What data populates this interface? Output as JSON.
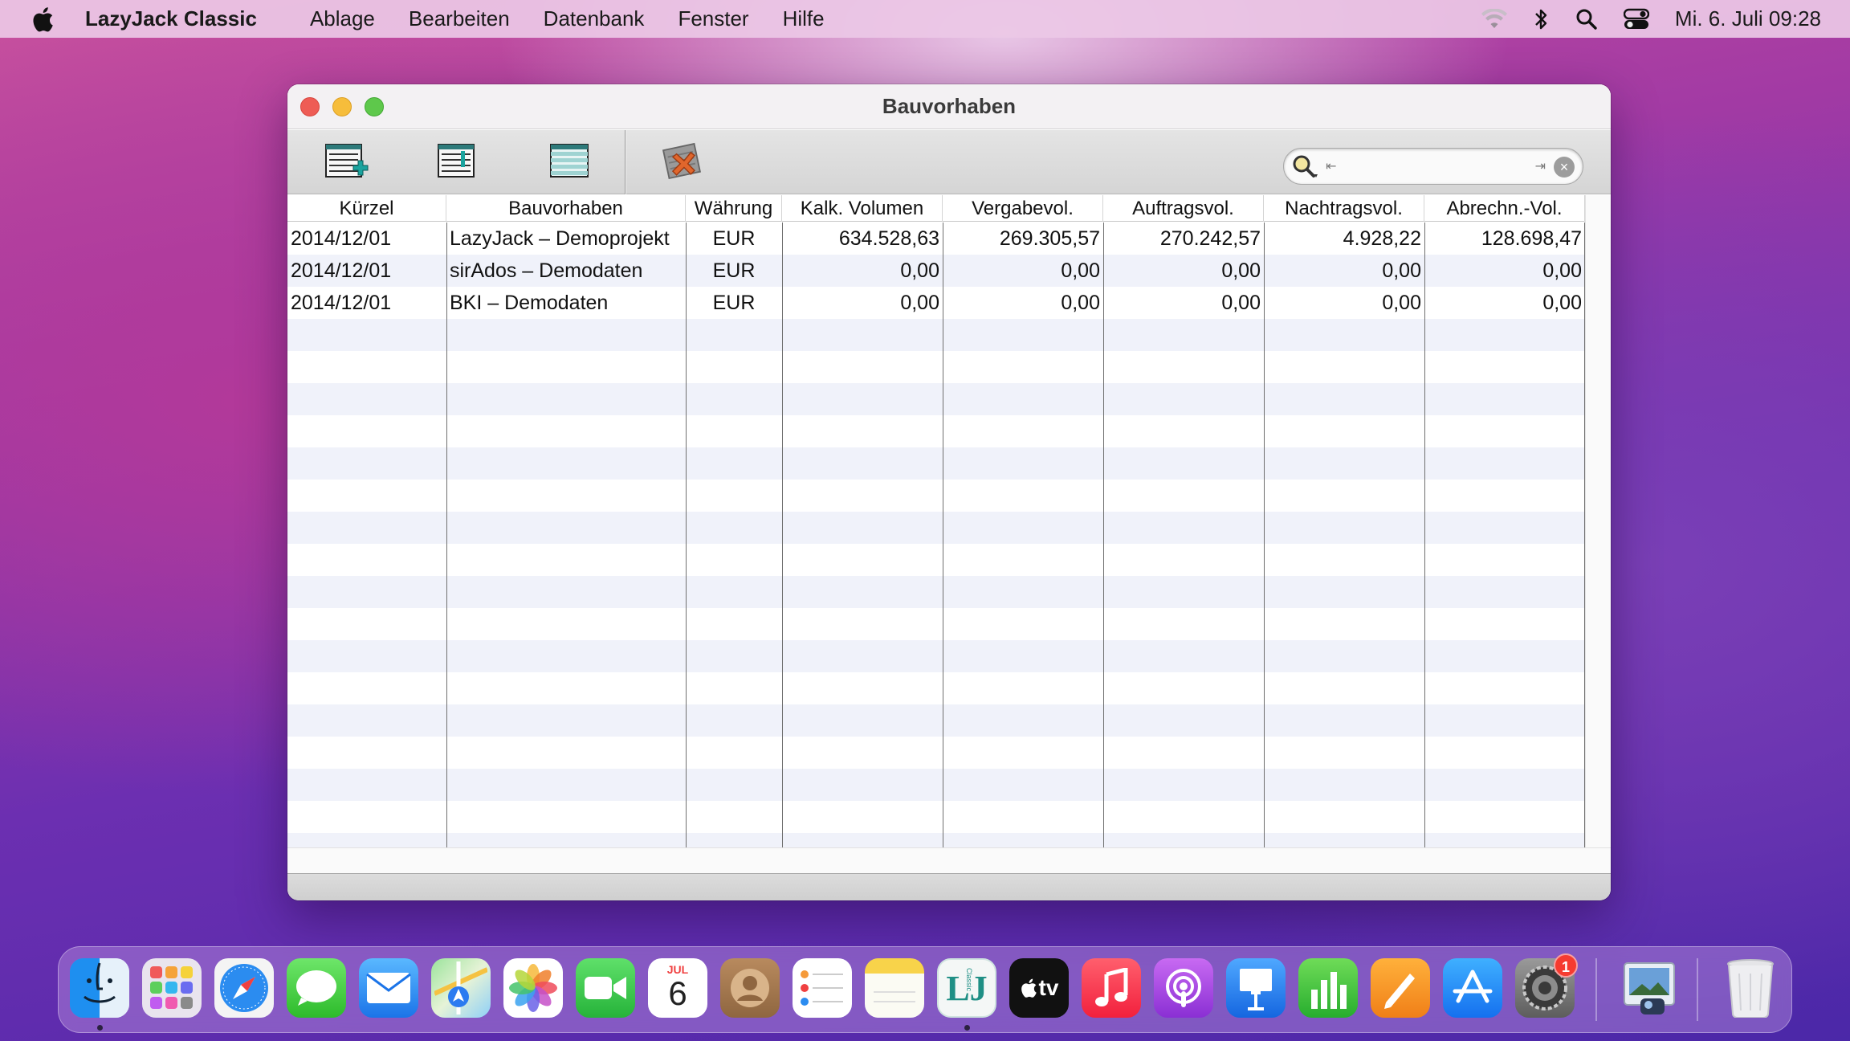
{
  "menubar": {
    "app_name": "LazyJack Classic",
    "menus": [
      "Ablage",
      "Bearbeiten",
      "Datenbank",
      "Fenster",
      "Hilfe"
    ],
    "clock": "Mi. 6. Juli  09:28"
  },
  "window": {
    "title": "Bauvorhaben"
  },
  "toolbar": {
    "buttons": [
      "new-record-icon",
      "edit-record-icon",
      "list-view-icon",
      "delete-record-icon"
    ]
  },
  "search": {
    "value": "",
    "clear_glyph": "×",
    "stop_left": "⇤",
    "stop_right": "⇥"
  },
  "table": {
    "headers": [
      "Kürzel",
      "Bauvorhaben",
      "Währung",
      "Kalk. Volumen",
      "Vergabevol.",
      "Auftragsvol.",
      "Nachtragsvol.",
      "Abrechn.-Vol."
    ],
    "rows": [
      [
        "2014/12/01",
        "LazyJack – Demoprojekt",
        "EUR",
        "634.528,63",
        "269.305,57",
        "270.242,57",
        "4.928,22",
        "128.698,47"
      ],
      [
        "2014/12/01",
        "sirAdos – Demodaten",
        "EUR",
        "0,00",
        "0,00",
        "0,00",
        "0,00",
        "0,00"
      ],
      [
        "2014/12/01",
        "BKI – Demodaten",
        "EUR",
        "0,00",
        "0,00",
        "0,00",
        "0,00",
        "0,00"
      ]
    ]
  },
  "dock": {
    "calendar_month": "JUL",
    "calendar_day": "6",
    "tv_label": "tv",
    "lj_label": "LJ",
    "lj_sub": "Classic",
    "settings_badge": "1",
    "apps": [
      "Finder",
      "Launchpad",
      "Safari",
      "Nachrichten",
      "Mail",
      "Karten",
      "Fotos",
      "FaceTime",
      "Kalender",
      "Kontakte",
      "Erinnerungen",
      "Notizen",
      "LazyJack Classic",
      "TV",
      "Musik",
      "Podcasts",
      "Keynote",
      "Numbers",
      "Pages",
      "App Store",
      "Systemeinstellungen",
      "Vorschau",
      "Papierkorb"
    ]
  },
  "colors": {
    "accent_close": "#ee5c55",
    "accent_min": "#f6bd3b",
    "accent_max": "#5ec84b",
    "row_alt": "#f0f2fa"
  }
}
